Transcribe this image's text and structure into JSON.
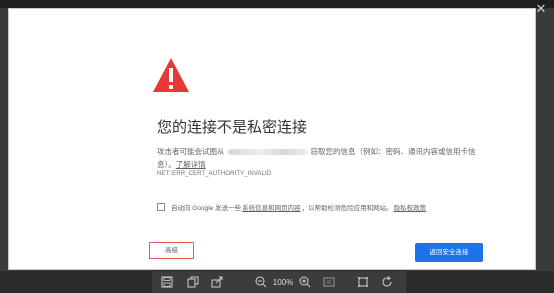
{
  "error_page": {
    "title": "您的连接不是私密连接",
    "body_prefix": "攻击者可能会试图从",
    "body_suffix": "窃取您的信息（例如：密码、通讯内容或信用卡信息）。",
    "learn_more": "了解详情",
    "error_code": "NET::ERR_CERT_AUTHORITY_INVALID",
    "report_prefix": "自动向 Google 发送一些",
    "report_link": "系统信息和网页内容",
    "report_suffix": "，以帮助检测危险应用和网站。",
    "privacy_link": "隐私权政策",
    "advanced_button": "高级",
    "back_button": "返回安全连接"
  },
  "viewer": {
    "zoom": "100%"
  },
  "colors": {
    "warning_red": "#e53935",
    "primary_blue": "#1a73e8",
    "advanced_outline": "#e35b5b"
  },
  "icons": {
    "warning": "warning-triangle-icon",
    "close": "close-icon"
  }
}
